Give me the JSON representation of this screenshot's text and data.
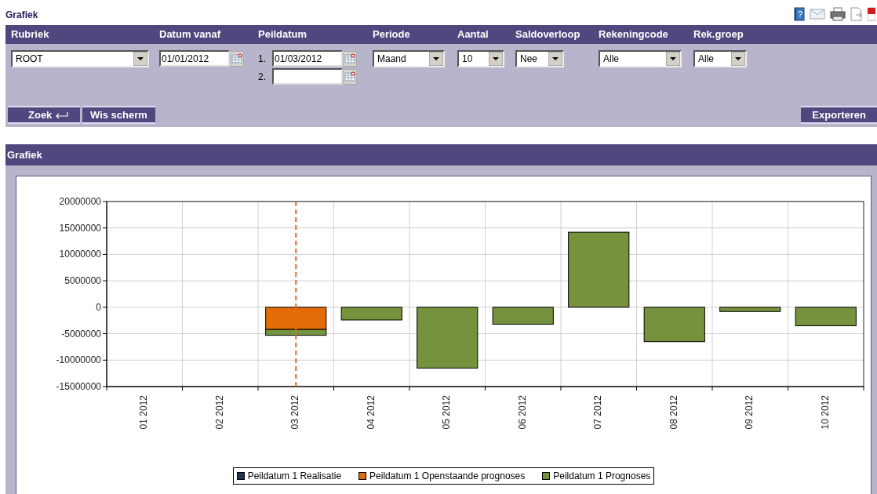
{
  "page_title": "Grafiek",
  "help_icon_glyph": "?",
  "filters": [
    {
      "kind": "select",
      "label": "Rubriek",
      "value": "ROOT"
    },
    {
      "kind": "date",
      "label": "Datum vanaf",
      "value": "01/01/2012"
    },
    {
      "kind": "dates",
      "label": "Peildatum",
      "fields": [
        {
          "number": "1.",
          "value": "01/03/2012"
        },
        {
          "number": "2."
        }
      ]
    },
    {
      "kind": "select",
      "label": "Periode",
      "value": "Maand"
    },
    {
      "kind": "select",
      "label": "Aantal",
      "value": "10"
    },
    {
      "kind": "select",
      "label": "Saldoverloop",
      "value": "Nee"
    },
    {
      "kind": "select",
      "label": "Rekeningcode",
      "value": "Alle"
    },
    {
      "kind": "select",
      "label": "Rek.groep",
      "value": "Alle"
    }
  ],
  "buttons": [
    "Zoek",
    "Wis scherm"
  ],
  "export_button": "Exporteren",
  "chart_panel": {
    "title": "Grafiek",
    "chart_data": {
      "type": "bar",
      "stacked": true,
      "categories": [
        "01 2012",
        "02 2012",
        "03 2012",
        "04 2012",
        "05 2012",
        "06 2012",
        "07 2012",
        "08 2012",
        "09 2012",
        "10 2012"
      ],
      "series": [
        {
          "name": "Peildatum 1 Realisatie",
          "color": "#1f3552",
          "values": [
            null,
            null,
            null,
            null,
            null,
            null,
            null,
            null,
            null,
            null
          ]
        },
        {
          "name": "Peildatum 1 Openstaande prognoses",
          "color": "#e36c09",
          "values": [
            null,
            null,
            -4200000,
            null,
            null,
            null,
            null,
            null,
            null,
            null
          ]
        },
        {
          "name": "Peildatum 1 Prognoses",
          "color": "#76923c",
          "values": [
            null,
            null,
            -1100000,
            -2400000,
            -11500000,
            -3200000,
            14200000,
            -6500000,
            -800000,
            -3500000
          ]
        }
      ],
      "ylim": [
        -15000000,
        20000000
      ],
      "yticks": [
        {
          "value": 20000000,
          "label": "20000000"
        },
        {
          "value": 15000000,
          "label": "15000000"
        },
        {
          "value": 10000000,
          "label": "10000000"
        },
        {
          "value": 5000000,
          "label": "5000000"
        },
        {
          "value": 0,
          "label": "0"
        },
        {
          "value": -5000000,
          "label": "-5000000"
        },
        {
          "value": -10000000,
          "label": "-10000000"
        },
        {
          "value": -15000000,
          "label": "-15000000"
        }
      ],
      "grid": true,
      "ref_lines": [
        {
          "axis": "x",
          "value": "03 2012",
          "color": "#f26522"
        }
      ]
    }
  }
}
